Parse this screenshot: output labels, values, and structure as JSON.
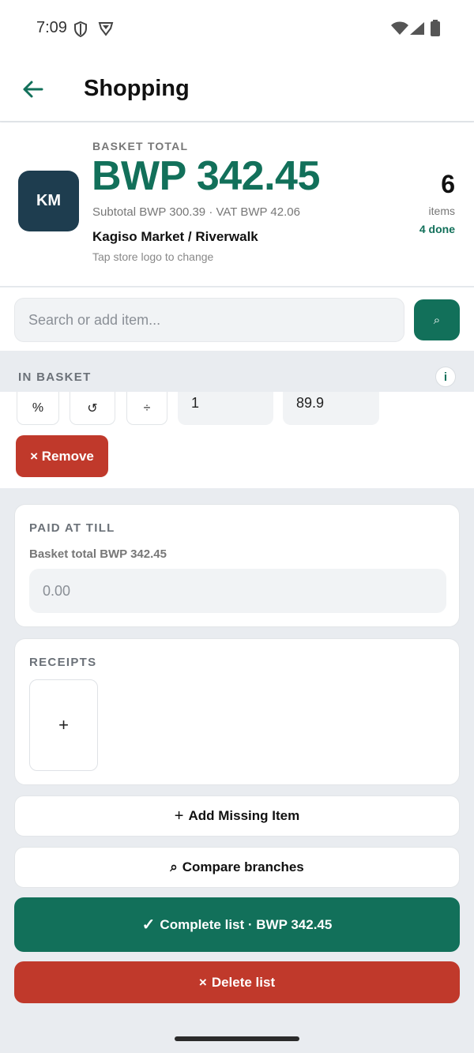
{
  "status_bar": {
    "time": "7:09"
  },
  "header": {
    "title": "Shopping"
  },
  "summary": {
    "store_logo": "KM",
    "basket_label": "BASKET TOTAL",
    "total": "BWP 342.45",
    "subtotal": "Subtotal BWP 300.39 · VAT BWP 42.06",
    "store_name": "Kagiso Market / Riverwalk",
    "store_hint": "Tap store logo to change",
    "item_count": "6",
    "items_label": "items",
    "done_label": "4 done"
  },
  "search": {
    "placeholder": "Search or add item...",
    "button_icon": "⌕"
  },
  "in_basket": {
    "label": "IN BASKET",
    "info_icon": "i",
    "tools": {
      "percent": "%",
      "reset": "↺",
      "divide": "÷"
    },
    "quantity": "1",
    "price": "89.9",
    "remove_label": "× Remove"
  },
  "paid_at_till": {
    "label": "PAID AT TILL",
    "basket_total_label": "Basket total BWP 342.45",
    "placeholder": "0.00"
  },
  "receipts": {
    "label": "RECEIPTS",
    "add_icon": "+"
  },
  "actions": {
    "add_missing_icon": "+",
    "add_missing": "Add Missing Item",
    "compare_icon": "⌕",
    "compare": "Compare branches",
    "complete_icon": "✓",
    "complete": "Complete list · BWP 342.45",
    "delete_icon": "×",
    "delete": "Delete list"
  },
  "colors": {
    "accent": "#12705a",
    "danger": "#c0392b",
    "logo_bg": "#1e3d4f"
  }
}
